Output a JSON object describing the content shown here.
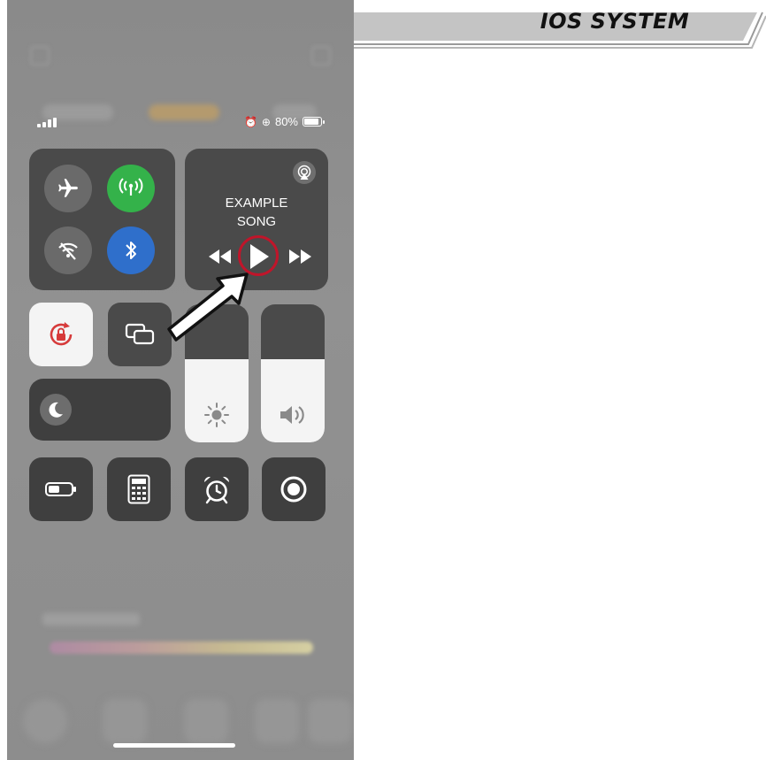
{
  "banner": {
    "title": "IOS SYSTEM"
  },
  "status_bar": {
    "battery_percent": "80%",
    "battery_level": 0.8
  },
  "control_center": {
    "connectivity": {
      "airplane_mode": "airplane-icon",
      "cellular_data": "antenna-icon",
      "wifi": "wifi-off-icon",
      "bluetooth": "bluetooth-icon"
    },
    "now_playing": {
      "song_line1": "EXAMPLE",
      "song_line2": "SONG"
    },
    "brightness_level": 0.6,
    "volume_level": 0.6
  },
  "colors": {
    "cellular_active": "#34b24a",
    "bluetooth_active": "#2f6fcb",
    "highlight_ring": "#c0152a",
    "banner_fill": "#c2c2c2"
  }
}
